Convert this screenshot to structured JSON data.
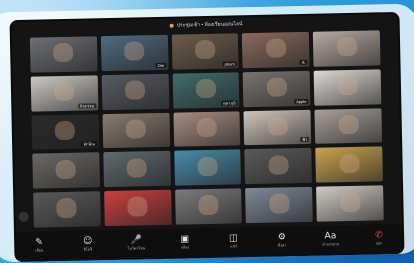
{
  "meeting": {
    "title": "ประชุมเช้า • ห้องเรียนออนไลน์"
  },
  "participants": [
    {
      "name": "",
      "bg": "#6d6f74"
    },
    {
      "name": "Zim",
      "bg": "#4f6a7f"
    },
    {
      "name": "phorn",
      "bg": "#6d5c4a"
    },
    {
      "name": "S.",
      "bg": "#8a6a5c"
    },
    {
      "name": "",
      "bg": "#b7aaa4"
    },
    {
      "name": "กิจกรรม",
      "bg": "#ccc9c5"
    },
    {
      "name": "",
      "bg": "#565c63"
    },
    {
      "name": "ตุลาภูมิ",
      "bg": "#3f6d6b"
    },
    {
      "name": "Apple",
      "bg": "#7a7470"
    },
    {
      "name": "",
      "bg": "#ded9d3"
    },
    {
      "name": "ทักษิณ",
      "bg": "#2a2a2a"
    },
    {
      "name": "",
      "bg": "#8a7a70"
    },
    {
      "name": "",
      "bg": "#a88c82"
    },
    {
      "name": "ฟ้า",
      "bg": "#cfc6bd"
    },
    {
      "name": "",
      "bg": "#a8a09a"
    },
    {
      "name": "",
      "bg": "#6b6864"
    },
    {
      "name": "",
      "bg": "#5f6a6e"
    },
    {
      "name": "",
      "bg": "#4a8ba8"
    },
    {
      "name": "",
      "bg": "#5a5a5a"
    },
    {
      "name": "",
      "bg": "#c9a34c"
    },
    {
      "name": "",
      "bg": "#595959"
    },
    {
      "name": "",
      "bg": "#c94040"
    },
    {
      "name": "",
      "bg": "#7b7b7b"
    },
    {
      "name": "",
      "bg": "#7e8a96"
    },
    {
      "name": "",
      "bg": "#d1cbc4"
    }
  ],
  "toolbar": [
    {
      "icon": "✎",
      "icon_name": "pencil-icon",
      "label": "เขียน"
    },
    {
      "icon": "☺",
      "icon_name": "emoji-icon",
      "label": "อิโมจิ"
    },
    {
      "icon": "🎤",
      "icon_name": "microphone-icon",
      "label": "ไมโครโฟน"
    },
    {
      "icon": "▣",
      "icon_name": "camera-icon",
      "label": "กล้อง"
    },
    {
      "icon": "◫",
      "icon_name": "layout-icon",
      "label": "แชร์"
    },
    {
      "icon": "⚙",
      "icon_name": "settings-icon",
      "label": "ตั้งค่า"
    },
    {
      "icon": "Aa",
      "icon_name": "captions-icon",
      "label": "คำบรรยาย"
    },
    {
      "icon": "✆",
      "icon_name": "leave-call-icon",
      "label": "ออก"
    }
  ]
}
